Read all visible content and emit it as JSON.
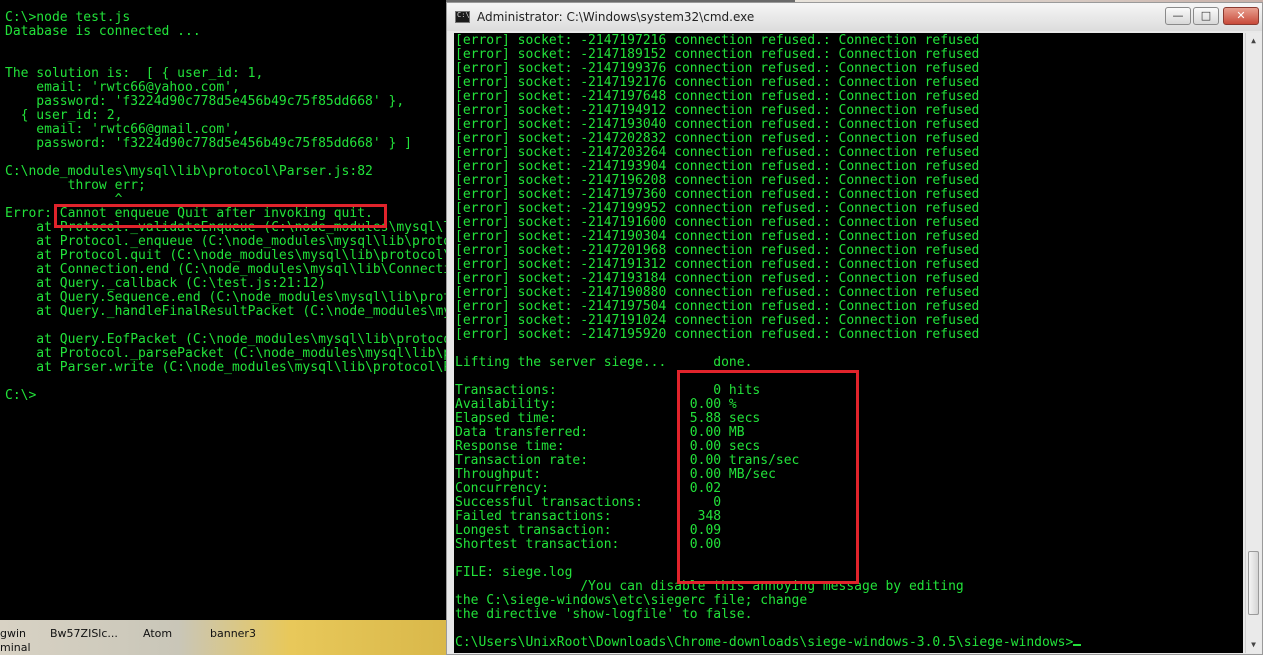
{
  "left_console": {
    "lines": [
      "C:\\>node test.js",
      "Database is connected ...",
      "",
      "",
      "The solution is:  [ { user_id: 1,",
      "    email: 'rwtc66@yahoo.com',",
      "    password: 'f3224d90c778d5e456b49c75f85dd668' },",
      "  { user_id: 2,",
      "    email: 'rwtc66@gmail.com',",
      "    password: 'f3224d90c778d5e456b49c75f85dd668' } ]",
      "",
      "C:\\node_modules\\mysql\\lib\\protocol\\Parser.js:82",
      "        throw err;",
      "              ^",
      "Error: Cannot enqueue Quit after invoking quit.",
      "    at Protocol._validateEnqueue (C:\\node_modules\\mysql\\lib\\protocol\\Protocol.js",
      "    at Protocol._enqueue (C:\\node_modules\\mysql\\lib\\protocol\\Protocol.js",
      "    at Protocol.quit (C:\\node_modules\\mysql\\lib\\protocol\\Protocol.js",
      "    at Connection.end (C:\\node_modules\\mysql\\lib\\Connection.js",
      "    at Query._callback (C:\\test.js:21:12)",
      "    at Query.Sequence.end (C:\\node_modules\\mysql\\lib\\protocol\\sequences",
      "    at Query._handleFinalResultPacket (C:\\node_modules\\mysql\\lib\\protocol",
      "",
      "    at Query.EofPacket (C:\\node_modules\\mysql\\lib\\protocol\\sequences",
      "    at Protocol._parsePacket (C:\\node_modules\\mysql\\lib\\protocol\\Protocol",
      "    at Parser.write (C:\\node_modules\\mysql\\lib\\protocol\\Parser.js",
      "",
      "C:\\>"
    ]
  },
  "desktop": {
    "icons": [
      "gwin",
      "Bw57ZISlc...",
      "Atom",
      "banner3"
    ],
    "partial_label": "minal"
  },
  "cmd_window": {
    "title": "Administrator: C:\\Windows\\system32\\cmd.exe",
    "buttons": {
      "minimize": "—",
      "maximize": "□",
      "close": "✕"
    },
    "lines": [
      "[error] socket: -2147197216 connection refused.: Connection refused",
      "[error] socket: -2147189152 connection refused.: Connection refused",
      "[error] socket: -2147199376 connection refused.: Connection refused",
      "[error] socket: -2147192176 connection refused.: Connection refused",
      "[error] socket: -2147197648 connection refused.: Connection refused",
      "[error] socket: -2147194912 connection refused.: Connection refused",
      "[error] socket: -2147193040 connection refused.: Connection refused",
      "[error] socket: -2147202832 connection refused.: Connection refused",
      "[error] socket: -2147203264 connection refused.: Connection refused",
      "[error] socket: -2147193904 connection refused.: Connection refused",
      "[error] socket: -2147196208 connection refused.: Connection refused",
      "[error] socket: -2147197360 connection refused.: Connection refused",
      "[error] socket: -2147199952 connection refused.: Connection refused",
      "[error] socket: -2147191600 connection refused.: Connection refused",
      "[error] socket: -2147190304 connection refused.: Connection refused",
      "[error] socket: -2147201968 connection refused.: Connection refused",
      "[error] socket: -2147191312 connection refused.: Connection refused",
      "[error] socket: -2147193184 connection refused.: Connection refused",
      "[error] socket: -2147190880 connection refused.: Connection refused",
      "[error] socket: -2147197504 connection refused.: Connection refused",
      "[error] socket: -2147191024 connection refused.: Connection refused",
      "[error] socket: -2147195920 connection refused.: Connection refused",
      "",
      "Lifting the server siege...      done.",
      "",
      "Transactions:                    0 hits",
      "Availability:                 0.00 %",
      "Elapsed time:                 5.88 secs",
      "Data transferred:             0.00 MB",
      "Response time:                0.00 secs",
      "Transaction rate:             0.00 trans/sec",
      "Throughput:                   0.00 MB/sec",
      "Concurrency:                  0.02",
      "Successful transactions:         0",
      "Failed transactions:           348",
      "Longest transaction:          0.09",
      "Shortest transaction:         0.00",
      "",
      "FILE: siege.log",
      "                /You can disable this annoying message by editing",
      "the C:\\siege-windows\\etc\\siegerc file; change",
      "the directive 'show-logfile' to false.",
      "",
      "C:\\Users\\UnixRoot\\Downloads\\Chrome-downloads\\siege-windows-3.0.5\\siege-windows>"
    ]
  },
  "colors": {
    "terminal_text": "#22e23a",
    "terminal_bg": "#000000",
    "highlight": "#e0232b"
  }
}
